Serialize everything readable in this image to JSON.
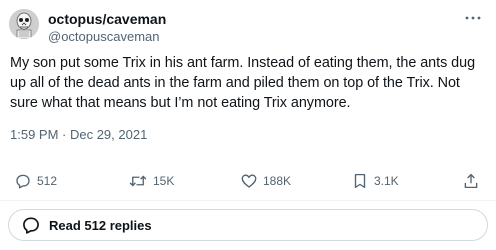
{
  "author": {
    "display_name": "octopus/caveman",
    "handle": "@octopuscaveman"
  },
  "tweet": {
    "text": "My son put some Trix in his ant farm. Instead of eating them, the ants dug up all of the dead ants in the farm and piled them on top of the Trix. Not sure what that means but I’m not eating Trix anymore.",
    "timestamp": "1:59 PM · Dec 29, 2021"
  },
  "stats": {
    "replies": "512",
    "retweets": "15K",
    "likes": "188K",
    "bookmarks": "3.1K"
  },
  "read_replies_label": "Read 512 replies",
  "icons": [
    "avatar-skeleton",
    "more-icon",
    "reply-icon",
    "retweet-icon",
    "like-icon",
    "bookmark-icon",
    "share-icon",
    "reply-bubble-icon"
  ],
  "colors": {
    "text": "#0f1419",
    "secondary": "#536471",
    "border": "#cfd9de"
  }
}
